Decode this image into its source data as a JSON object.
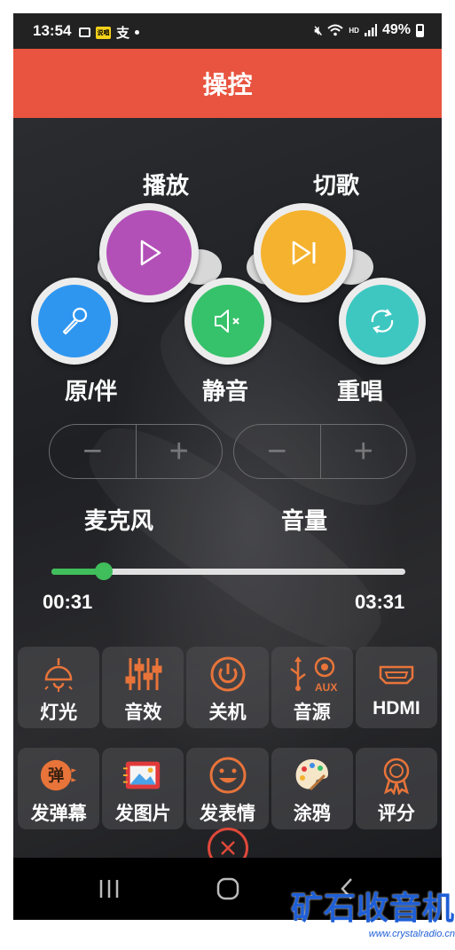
{
  "status_bar": {
    "time": "13:54",
    "notif_badge": "说唱",
    "notif_char": "支",
    "hd": "HD",
    "battery": "49%"
  },
  "title_bar": {
    "title": "操控"
  },
  "controls": {
    "play": {
      "label": "播放",
      "color": "#b250b8",
      "icon": "play-icon"
    },
    "skip": {
      "label": "切歌",
      "color": "#f5b22e",
      "icon": "skip-icon"
    },
    "original": {
      "label": "原/伴",
      "color": "#2f96f0",
      "icon": "microphone-icon"
    },
    "mute": {
      "label": "静音",
      "color": "#36c26a",
      "icon": "mute-icon"
    },
    "replay": {
      "label": "重唱",
      "color": "#3ec7c1",
      "icon": "refresh-icon"
    }
  },
  "steppers": {
    "mic": {
      "label": "麦克风",
      "minus": "−",
      "plus": "+"
    },
    "volume": {
      "label": "音量",
      "minus": "−",
      "plus": "+"
    }
  },
  "playback": {
    "elapsed": "00:31",
    "total": "03:31",
    "progress_fraction": 0.147
  },
  "tiles_row1": [
    {
      "label": "灯光",
      "icon": "lamp-icon"
    },
    {
      "label": "音效",
      "icon": "equalizer-icon"
    },
    {
      "label": "关机",
      "icon": "power-icon"
    },
    {
      "label": "音源",
      "icon": "usb-aux-icon",
      "icon_text": "AUX"
    },
    {
      "label": "HDMI",
      "icon": "hdmi-icon"
    }
  ],
  "tiles_row2": [
    {
      "label": "发弹幕",
      "icon": "danmaku-icon",
      "icon_text": "弹"
    },
    {
      "label": "发图片",
      "icon": "image-icon"
    },
    {
      "label": "发表情",
      "icon": "smiley-icon"
    },
    {
      "label": "涂鸦",
      "icon": "palette-icon"
    },
    {
      "label": "评分",
      "icon": "award-icon"
    }
  ],
  "accent_color": "#e8543f",
  "tile_icon_color": "#e8743a",
  "watermark": {
    "main": "矿石收音机",
    "url": "www.crystalradio.cn"
  }
}
